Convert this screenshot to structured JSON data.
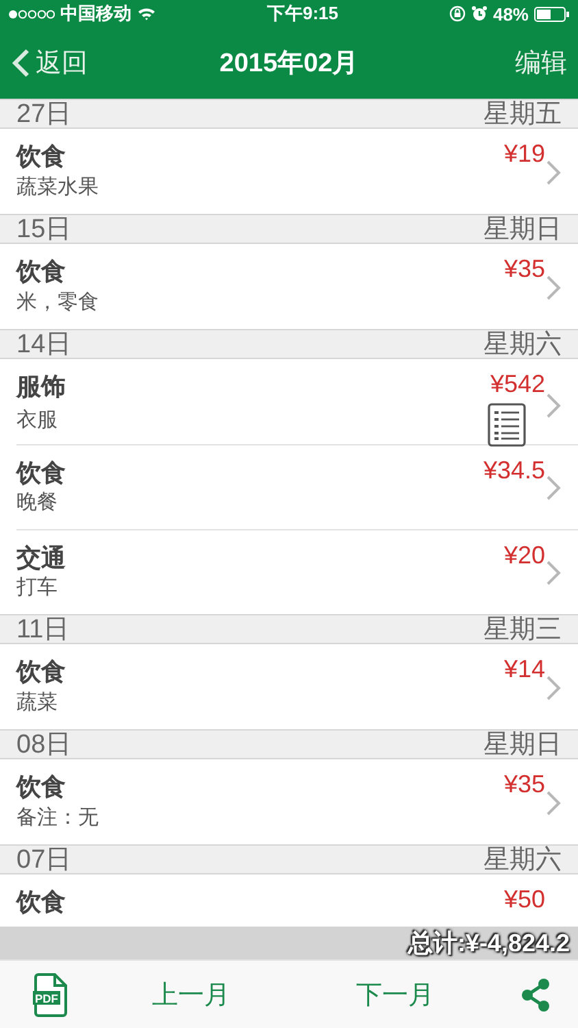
{
  "status_bar": {
    "carrier": "中国移动",
    "time": "下午9:15",
    "battery": "48%"
  },
  "nav": {
    "back": "返回",
    "title": "2015年02月",
    "edit": "编辑"
  },
  "days": [
    {
      "date": "27日",
      "weekday": "星期五",
      "entries": [
        {
          "category": "饮食",
          "note": "蔬菜水果",
          "amount": "¥19",
          "attachment": false,
          "chevron": true
        }
      ]
    },
    {
      "date": "15日",
      "weekday": "星期日",
      "entries": [
        {
          "category": "饮食",
          "note": "米，零食",
          "amount": "¥35",
          "attachment": false,
          "chevron": true
        }
      ]
    },
    {
      "date": "14日",
      "weekday": "星期六",
      "entries": [
        {
          "category": "服饰",
          "note": "衣服",
          "amount": "¥542",
          "attachment": true,
          "chevron": true
        },
        {
          "category": "饮食",
          "note": "晚餐",
          "amount": "¥34.5",
          "attachment": false,
          "chevron": true
        },
        {
          "category": "交通",
          "note": "打车",
          "amount": "¥20",
          "attachment": false,
          "chevron": true
        }
      ]
    },
    {
      "date": "11日",
      "weekday": "星期三",
      "entries": [
        {
          "category": "饮食",
          "note": "蔬菜",
          "amount": "¥14",
          "attachment": false,
          "chevron": true
        }
      ]
    },
    {
      "date": "08日",
      "weekday": "星期日",
      "entries": [
        {
          "category": "饮食",
          "note": "备注：无",
          "amount": "¥35",
          "attachment": false,
          "chevron": true
        }
      ]
    },
    {
      "date": "07日",
      "weekday": "星期六",
      "entries": [
        {
          "category": "饮食",
          "amount": "¥50",
          "attachment": false,
          "chevron": false
        }
      ]
    }
  ],
  "total": "总计:¥-4,824.2",
  "toolbar": {
    "pdf_label": "PDF",
    "prev": "上一月",
    "next": "下一月"
  }
}
